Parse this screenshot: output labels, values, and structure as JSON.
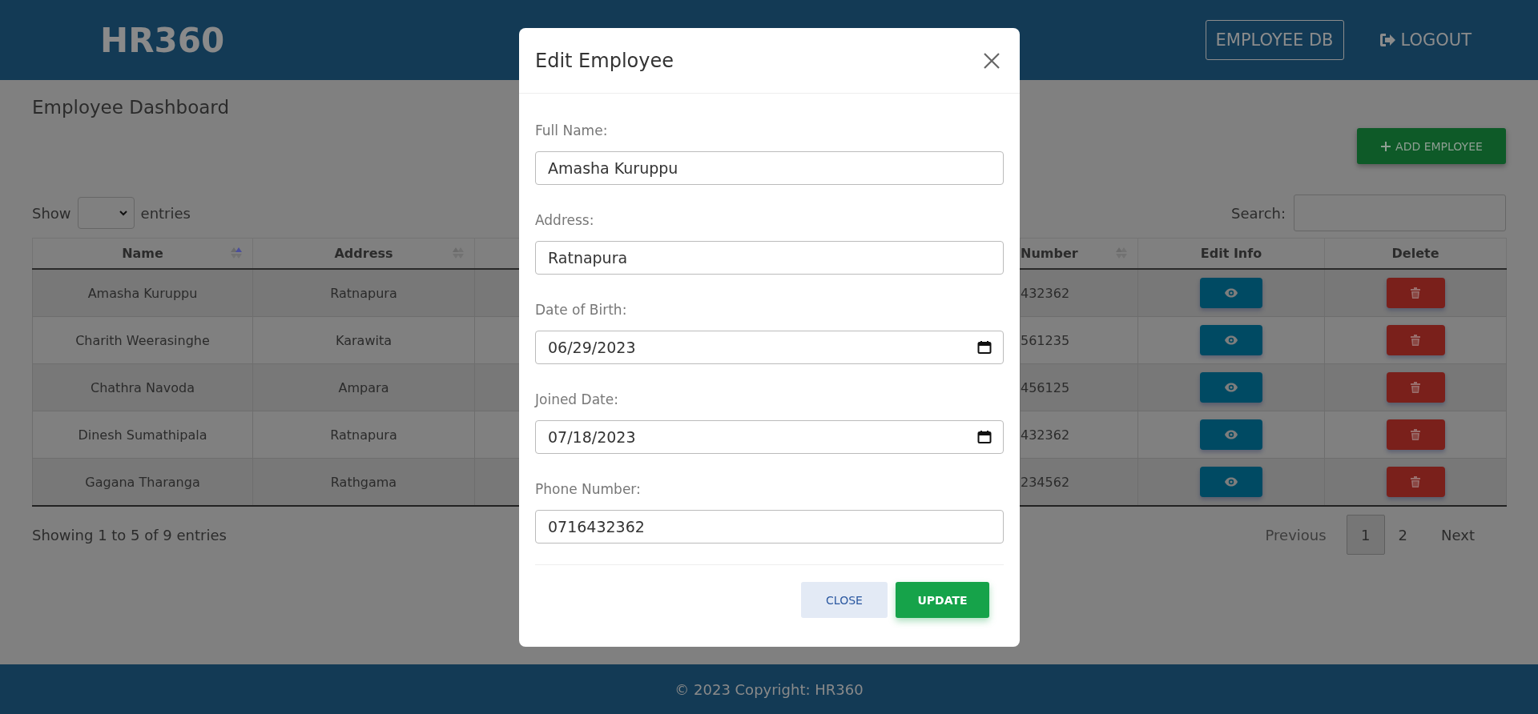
{
  "header": {
    "logo": "HR360",
    "nav": [
      {
        "label": "EMPLOYEE DB",
        "kind": "boxed"
      },
      {
        "label": "LOGOUT",
        "kind": "logout"
      }
    ]
  },
  "dashboard": {
    "title": "Employee Dashboard",
    "add_button": "ADD EMPLOYEE"
  },
  "table_controls": {
    "show_label": "Show",
    "entries_label": "entries",
    "search_label": "Search:"
  },
  "table": {
    "columns": [
      {
        "label": "Name",
        "sortable": true,
        "sorted": true
      },
      {
        "label": "Address",
        "sortable": true,
        "sorted": false
      },
      {
        "label": "Number",
        "sortable": true,
        "sorted": false
      },
      {
        "label": "Edit Info"
      },
      {
        "label": "Delete"
      }
    ],
    "rows": [
      {
        "name": "Amasha Kuruppu",
        "address": "Ratnapura",
        "number": "432362"
      },
      {
        "name": "Charith Weerasinghe",
        "address": "Karawita",
        "number": "561235"
      },
      {
        "name": "Chathra Navoda",
        "address": "Ampara",
        "number": "456125"
      },
      {
        "name": "Dinesh Sumathipala",
        "address": "Ratnapura",
        "number": "432362"
      },
      {
        "name": "Gagana Tharanga",
        "address": "Rathgama",
        "number": "234562"
      }
    ]
  },
  "info": "Showing 1 to 5 of 9 entries",
  "pagination": {
    "previous": "Previous",
    "pages": [
      {
        "label": "1",
        "selected": true
      },
      {
        "label": "2",
        "selected": false
      }
    ],
    "next": "Next"
  },
  "modal": {
    "title": "Edit Employee",
    "fields": [
      {
        "label": "Full Name:",
        "value": "Amasha Kuruppu",
        "kind": "text"
      },
      {
        "label": "Address:",
        "value": "Ratnapura",
        "kind": "text"
      },
      {
        "label": "Date of Birth:",
        "value": "06/29/2023",
        "kind": "date"
      },
      {
        "label": "Joined Date:",
        "value": "07/18/2023",
        "kind": "date"
      },
      {
        "label": "Phone Number:",
        "value": "0716432362",
        "kind": "text"
      }
    ],
    "buttons": [
      {
        "label": "CLOSE",
        "kind": "secondary"
      },
      {
        "label": "UPDATE",
        "kind": "primary"
      }
    ]
  },
  "footer": "© 2023 Copyright: HR360"
}
